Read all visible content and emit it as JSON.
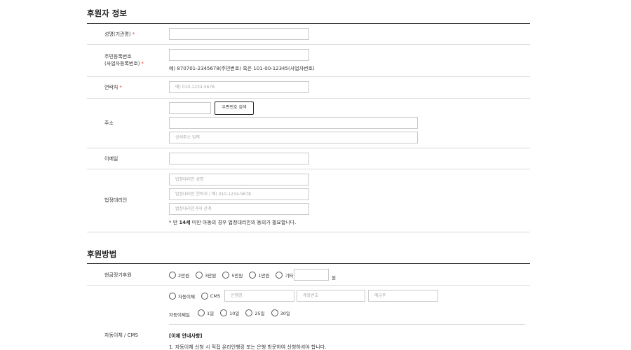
{
  "donor_section": {
    "title": "후원자 정보",
    "name": {
      "label": "성명(기관명)",
      "required_mark": "*",
      "value": ""
    },
    "rrn": {
      "label_line1": "주민등록번호",
      "label_line2": "(사업자등록번호)",
      "required_mark": "*",
      "value": "",
      "help": "예) 870701-2345678(주민번호) 혹은 101-00-12345(사업자번호)"
    },
    "phone": {
      "label": "연락처",
      "required_mark": "*",
      "placeholder": "예) 010-1234-5678"
    },
    "address": {
      "label": "주소",
      "zip_value": "",
      "search_button": "우편번호 검색",
      "address1_value": "",
      "detail_placeholder": "상세주소 입력"
    },
    "email": {
      "label": "이메일",
      "value": ""
    },
    "guardian": {
      "label": "법정대리인",
      "name_placeholder": "법정대리인 성명",
      "phone_placeholder": "법정대리인 연락처 / 예) 010-1234-5678",
      "relation_placeholder": "법정대리인과의 관계",
      "note_prefix": "* 만 ",
      "note_bold": "14세",
      "note_suffix": " 미만 아동의 경우 법정대리인의 동의가 필요합니다."
    }
  },
  "method_section": {
    "title": "후원방법",
    "regular": {
      "label": "현금정기후원",
      "options": [
        "2만원",
        "3만원",
        "5만원",
        "1만원",
        "기타"
      ],
      "other_value": "",
      "unit": "원"
    },
    "transfer": {
      "label": "자동이체 / CMS",
      "type_options": [
        "자동이체",
        "CMS"
      ],
      "bank_placeholder": "은행명",
      "account_placeholder": "계좌번호",
      "holder_placeholder": "예금주",
      "day_label": "자동이체일",
      "day_options": [
        "1일",
        "10일",
        "25일",
        "30일"
      ],
      "notice_title": "[이체 안내사항]",
      "notice_line1": "1. 자동이체 신청 시 직접 온라인뱅킹 또는 은행 방문하여 신청하셔야 합니다."
    }
  }
}
